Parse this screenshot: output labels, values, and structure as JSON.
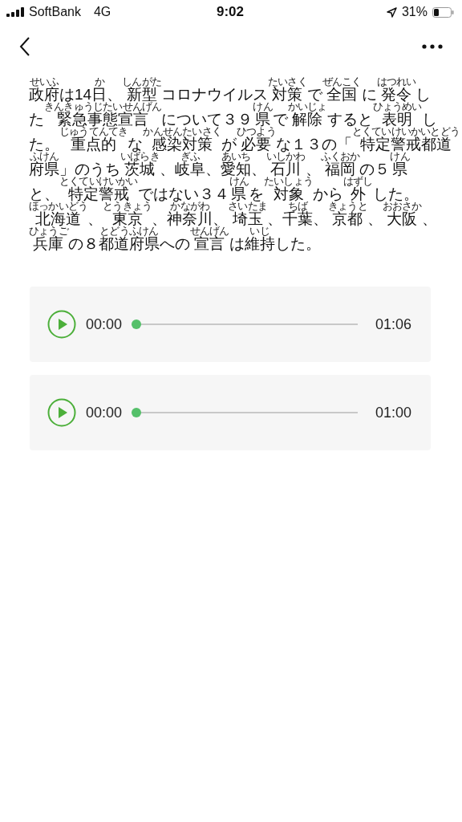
{
  "status_bar": {
    "carrier": "SoftBank",
    "network": "4G",
    "time": "9:02",
    "battery": "31%"
  },
  "article": {
    "lines": [
      [
        {
          "t": "政府",
          "r": "せいふ"
        },
        {
          "t": "は14"
        },
        {
          "t": "日",
          "r": "か"
        },
        {
          "t": "、"
        },
        {
          "t": "新型",
          "r": "しんがた"
        },
        {
          "t": "コロナウイルス"
        },
        {
          "t": "対策",
          "r": "たいさく"
        },
        {
          "t": "で"
        },
        {
          "t": "全国",
          "r": "ぜんこく"
        },
        {
          "t": "に"
        },
        {
          "t": "発令",
          "r": "はつれい"
        },
        {
          "t": "し"
        }
      ],
      [
        {
          "t": "た"
        },
        {
          "t": "緊急事態宣言",
          "r": "きんきゅうじたいせんげん"
        },
        {
          "t": "について３９"
        },
        {
          "t": "県",
          "r": "けん"
        },
        {
          "t": "で"
        },
        {
          "t": "解除",
          "r": "かいじょ"
        },
        {
          "t": "すると"
        },
        {
          "t": "表明",
          "r": "ひょうめい"
        },
        {
          "t": "し"
        }
      ],
      [
        {
          "t": "た。"
        },
        {
          "t": "重点的",
          "r": "じゅうてんてき"
        },
        {
          "t": "な"
        },
        {
          "t": "感染対策",
          "r": "かんせんたいさく"
        },
        {
          "t": "が"
        },
        {
          "t": "必要",
          "r": "ひつよう"
        },
        {
          "t": "な１３の「"
        },
        {
          "t": "特定警戒都道",
          "r": "とくていけいかいとどう"
        }
      ],
      [
        {
          "t": "府県",
          "r": "ふけん"
        },
        {
          "t": "」のうち"
        },
        {
          "t": "茨城",
          "r": "いばらき"
        },
        {
          "t": "、"
        },
        {
          "t": "岐阜",
          "r": "ぎふ"
        },
        {
          "t": "、"
        },
        {
          "t": "愛知",
          "r": "あいち"
        },
        {
          "t": "、"
        },
        {
          "t": "石川",
          "r": "いしかわ"
        },
        {
          "t": "、"
        },
        {
          "t": "福岡",
          "r": "ふくおか"
        },
        {
          "t": "の５"
        },
        {
          "t": "県",
          "r": "けん"
        }
      ],
      [
        {
          "t": "と、"
        },
        {
          "t": "特定警戒",
          "r": "とくていけいかい"
        },
        {
          "t": "ではない３４"
        },
        {
          "t": "県",
          "r": "けん"
        },
        {
          "t": "を"
        },
        {
          "t": "対象",
          "r": "たいしょう"
        },
        {
          "t": "から"
        },
        {
          "t": "外",
          "r": "はずし"
        },
        {
          "t": "した。"
        }
      ],
      [
        {
          "t": "北海道",
          "r": "ほっかいどう"
        },
        {
          "t": "、"
        },
        {
          "t": "東京",
          "r": "とうきょう"
        },
        {
          "t": "、"
        },
        {
          "t": "神奈川",
          "r": "かながわ"
        },
        {
          "t": "、"
        },
        {
          "t": "埼玉",
          "r": "さいたま"
        },
        {
          "t": "、"
        },
        {
          "t": "千葉",
          "r": "ちば"
        },
        {
          "t": "、"
        },
        {
          "t": "京都",
          "r": "きょうと"
        },
        {
          "t": "、"
        },
        {
          "t": "大阪",
          "r": "おおさか"
        },
        {
          "t": "、"
        }
      ],
      [
        {
          "t": "兵庫",
          "r": "ひょうご"
        },
        {
          "t": "の８"
        },
        {
          "t": "都道府県",
          "r": "とどうふけん"
        },
        {
          "t": "への"
        },
        {
          "t": "宣言",
          "r": "せんげん"
        },
        {
          "t": "は"
        },
        {
          "t": "維持",
          "r": "いじ"
        },
        {
          "t": "した。"
        }
      ]
    ]
  },
  "audio_players": [
    {
      "current": "00:00",
      "duration": "01:06",
      "level": 0
    },
    {
      "current": "00:00",
      "duration": "01:00",
      "level": 0
    }
  ]
}
